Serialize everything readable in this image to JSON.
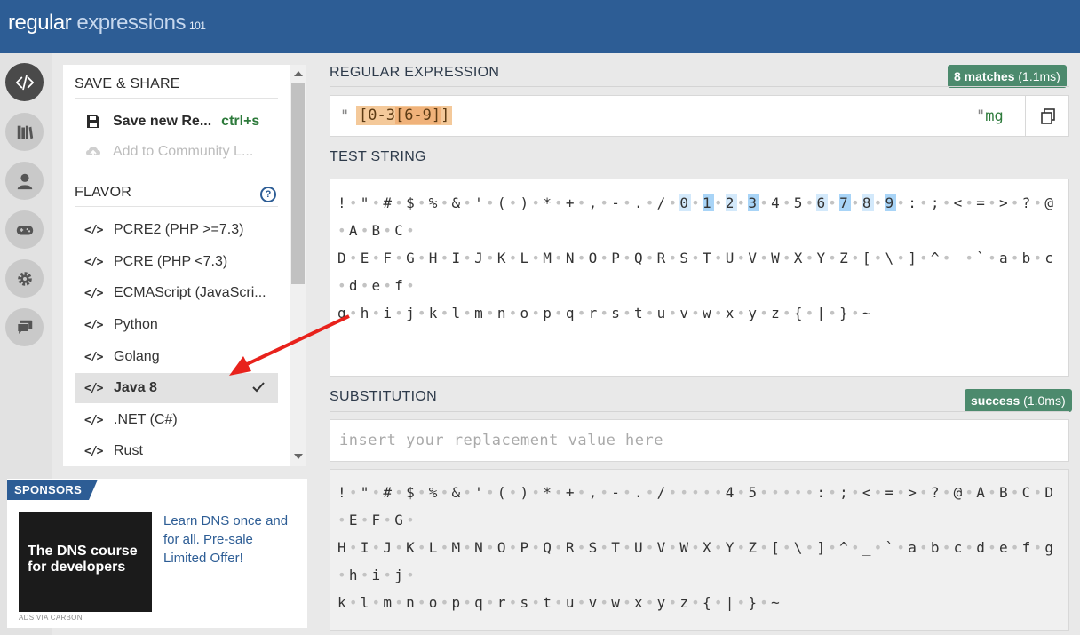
{
  "app": {
    "logo_main": "regular",
    "logo_accent": " expressions",
    "logo_version": "101"
  },
  "rail": [
    {
      "name": "editor",
      "icon": "code-icon",
      "active": true
    },
    {
      "name": "library",
      "icon": "library-icon"
    },
    {
      "name": "account",
      "icon": "user-icon"
    },
    {
      "name": "quiz",
      "icon": "gamepad-icon"
    },
    {
      "name": "settings",
      "icon": "gear-icon"
    },
    {
      "name": "chat",
      "icon": "chat-icon"
    }
  ],
  "sidebar": {
    "save_share_title": "SAVE & SHARE",
    "save_new_label": "Save new Re...",
    "save_shortcut": "ctrl+s",
    "add_community_label": "Add to Community L...",
    "flavor_title": "FLAVOR",
    "help_label": "?",
    "code_glyph": "</>",
    "flavors": [
      {
        "label": "PCRE2 (PHP >=7.3)",
        "selected": false
      },
      {
        "label": "PCRE (PHP <7.3)",
        "selected": false
      },
      {
        "label": "ECMAScript (JavaScri...",
        "selected": false
      },
      {
        "label": "Python",
        "selected": false
      },
      {
        "label": "Golang",
        "selected": false
      },
      {
        "label": "Java 8",
        "selected": true
      },
      {
        "label": ".NET (C#)",
        "selected": false
      },
      {
        "label": "Rust",
        "selected": false
      }
    ]
  },
  "sponsors": {
    "tag": "SPONSORS",
    "ad_title": "The DNS course for developers",
    "ad_text": "Learn DNS once and for all. Pre-sale Limited Offer!",
    "ads_via": "ADS VIA CARBON"
  },
  "regex": {
    "label": "REGULAR EXPRESSION",
    "match_count": "8 matches",
    "match_time": " (1.1ms)",
    "open_delim": "\"",
    "pattern_part1": "[0-3",
    "pattern_part2": "[6-9]",
    "pattern_part3": "]",
    "close_delim": "\"",
    "flags": "mg"
  },
  "test_string": {
    "label": "TEST STRING",
    "line1_pre": "!•\"•#•$•%•&•'•(•)•*•+•,•-•.•/•",
    "m0": "0",
    "m1": "1",
    "m2": "2",
    "m3": "3",
    "mid": "4•5•",
    "m6": "6",
    "m7": "7",
    "m8": "8",
    "m9": "9",
    "line1_post": ":•;•<•=•>•?•@•A•B•C•",
    "line2": "D•E•F•G•H•I•J•K•L•M•N•O•P•Q•R•S•T•U•V•W•X•Y•Z•[•\\•]•^•_•`•a•b•c•d•e•f•",
    "line3": "g•h•i•j•k•l•m•n•o•p•q•r•s•t•u•v•w•x•y•z•{•|•}•~"
  },
  "substitution": {
    "label": "SUBSTITUTION",
    "status": "success",
    "status_time": " (1.0ms)",
    "placeholder": "insert your replacement value here",
    "result_line1": "!•\"•#•$•%•&•'•(•)•*•+•,•-•.•/•••••4•5•••••:•;•<•=•>•?•@•A•B•C•D•E•F•G•",
    "result_line2": "H•I•J•K•L•M•N•O•P•Q•R•S•T•U•V•W•X•Y•Z•[•\\•]•^•_•`•a•b•c•d•e•f•g•h•i•j•",
    "result_line3": "k•l•m•n•o•p•q•r•s•t•u•v•w•x•y•z•{•|•}•~"
  },
  "colors": {
    "header": "#2d5d95",
    "badge": "#4c8a6d",
    "match_highlight": "#a8d4f7",
    "regex_highlight": "#f4c99a",
    "annotation_arrow": "#e8221c"
  }
}
